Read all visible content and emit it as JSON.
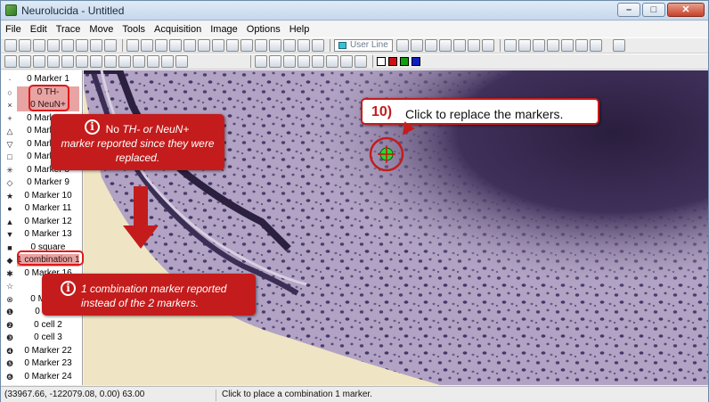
{
  "window": {
    "title": "Neurolucida - Untitled",
    "minimize": "–",
    "maximize": "□",
    "close": "✕"
  },
  "menu": [
    "File",
    "Edit",
    "Trace",
    "Move",
    "Tools",
    "Acquisition",
    "Image",
    "Options",
    "Help"
  ],
  "toolbar": {
    "contour_type": "User Line",
    "more": "»"
  },
  "marker_list": [
    {
      "symbol": "·",
      "label": "0 Marker 1"
    },
    {
      "symbol": "○",
      "label": "0 TH-",
      "highlight": true
    },
    {
      "symbol": "×",
      "label": "0 NeuN+",
      "highlight": true
    },
    {
      "symbol": "+",
      "label": "0 Marker 4"
    },
    {
      "symbol": "△",
      "label": "0 Marker 5"
    },
    {
      "symbol": "▽",
      "label": "0 Marker 6"
    },
    {
      "symbol": "□",
      "label": "0 Marker 7"
    },
    {
      "symbol": "✳",
      "label": "0 Marker 8"
    },
    {
      "symbol": "◇",
      "label": "0 Marker 9"
    },
    {
      "symbol": "★",
      "label": "0 Marker 10"
    },
    {
      "symbol": "●",
      "label": "0 Marker 11"
    },
    {
      "symbol": "▲",
      "label": "0 Marker 12"
    },
    {
      "symbol": "▼",
      "label": "0 Marker 13"
    },
    {
      "symbol": "■",
      "label": "0 square"
    },
    {
      "symbol": "◆",
      "label": "1 combination 1",
      "highlight": true
    },
    {
      "symbol": "✱",
      "label": "0 Marker 16"
    },
    {
      "symbol": "☆",
      "label": ""
    },
    {
      "symbol": "⊗",
      "label": "0 Marker"
    },
    {
      "symbol": "❶",
      "label": "0 cel 1"
    },
    {
      "symbol": "❷",
      "label": "0 cell 2"
    },
    {
      "symbol": "❸",
      "label": "0 cell 3"
    },
    {
      "symbol": "❹",
      "label": "0 Marker 22"
    },
    {
      "symbol": "❺",
      "label": "0 Marker 23"
    },
    {
      "symbol": "❻",
      "label": "0 Marker 24"
    }
  ],
  "callouts": {
    "no_marker": {
      "pre": "No ",
      "em": "TH- or NeuN+",
      "post": "marker reported since they were replaced."
    },
    "combination": {
      "text": "1 combination marker reported instead of the 2 markers."
    },
    "step": {
      "number": "10)",
      "text": "Click to replace the markers."
    }
  },
  "status": {
    "coords": "(33967.66, -122079.08, 0.00) 63.00",
    "message": "Click to place a combination 1 marker."
  },
  "colors": {
    "accent_red": "#c41c1c",
    "highlight": "#e8a3a3",
    "tissue": "#b7a9c8",
    "cursor_green": "#2fd52f"
  },
  "icons": [
    "new-file-icon",
    "open-icon",
    "save-icon",
    "print-icon",
    "zoom-in-icon",
    "zoom-out-icon",
    "marker-icon",
    "crosshair-icon",
    "info-icon"
  ]
}
